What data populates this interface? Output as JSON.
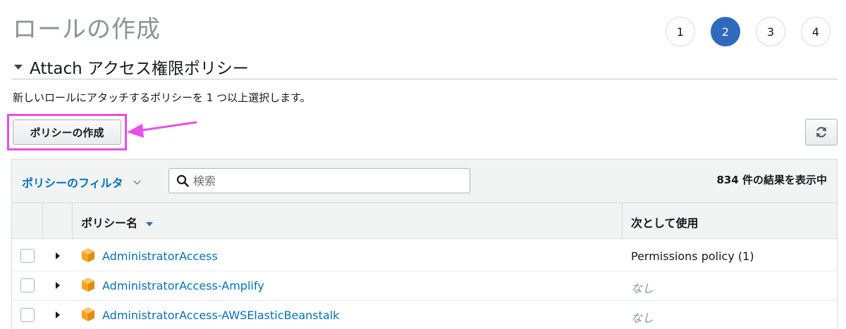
{
  "page": {
    "title": "ロールの作成"
  },
  "steps": [
    "1",
    "2",
    "3",
    "4"
  ],
  "active_step": 2,
  "section": {
    "title": "Attach アクセス権限ポリシー"
  },
  "description": "新しいロールにアタッチするポリシーを 1 つ以上選択します。",
  "create_policy_button": "ポリシーの作成",
  "filter": {
    "label": "ポリシーのフィルタ",
    "search_placeholder": "検索",
    "result_count": "834 件の結果を表示中"
  },
  "table": {
    "columns": {
      "name": "ポリシー名",
      "used_as": "次として使用"
    },
    "rows": [
      {
        "name": "AdministratorAccess",
        "used_as": "Permissions policy (1)"
      },
      {
        "name": "AdministratorAccess-Amplify",
        "used_as": "なし"
      },
      {
        "name": "AdministratorAccess-AWSElasticBeanstalk",
        "used_as": "なし"
      }
    ]
  },
  "colors": {
    "accent": "#2e6bbf",
    "link": "#0073bb",
    "highlight": "#e84ee8",
    "policy_icon": "#f7a51f"
  },
  "icons": {
    "search": "search-icon",
    "refresh": "refresh-icon",
    "policy": "aws-policy-cube-icon"
  }
}
